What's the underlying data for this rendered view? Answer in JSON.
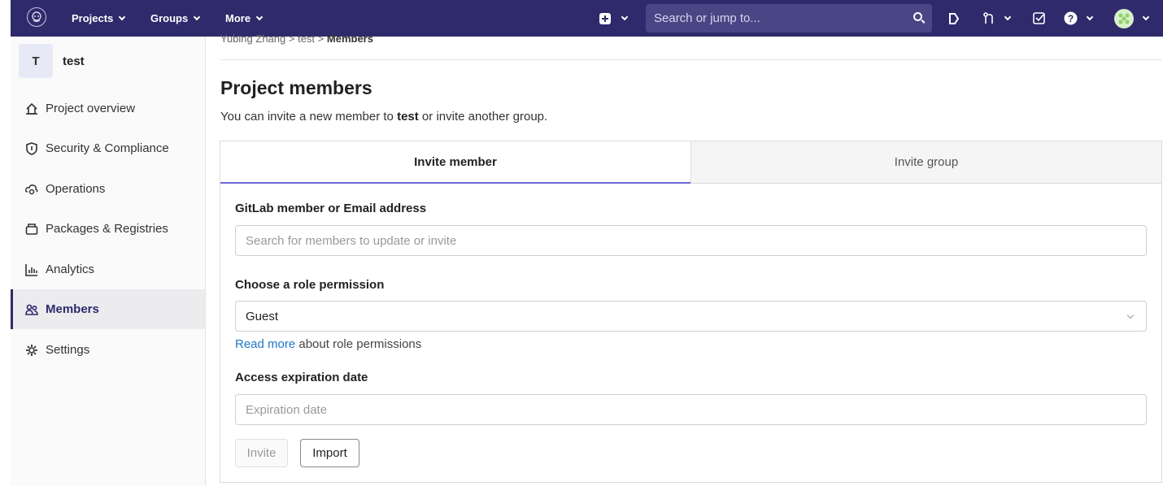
{
  "navbar": {
    "projects": "Projects",
    "groups": "Groups",
    "more": "More",
    "search_placeholder": "Search or jump to..."
  },
  "sidebar": {
    "project_initial": "T",
    "project_name": "test",
    "items": [
      {
        "label": "Project overview",
        "icon": "home-icon"
      },
      {
        "label": "Security & Compliance",
        "icon": "shield-icon"
      },
      {
        "label": "Operations",
        "icon": "cloud-gear-icon"
      },
      {
        "label": "Packages & Registries",
        "icon": "package-icon"
      },
      {
        "label": "Analytics",
        "icon": "chart-icon"
      },
      {
        "label": "Members",
        "icon": "users-icon",
        "active": true
      },
      {
        "label": "Settings",
        "icon": "gear-icon"
      }
    ]
  },
  "breadcrumb": {
    "owner": "Yubing Zhang",
    "sep1": ">",
    "project": "test",
    "sep2": ">",
    "current": "Members"
  },
  "main": {
    "title": "Project members",
    "subtitle_pre": "You can invite a new member to ",
    "subtitle_bold": "test",
    "subtitle_post": " or invite another group."
  },
  "tabs": {
    "invite_member": "Invite member",
    "invite_group": "Invite group"
  },
  "form": {
    "member_label": "GitLab member or Email address",
    "member_placeholder": "Search for members to update or invite",
    "role_label": "Choose a role permission",
    "role_value": "Guest",
    "read_more": "Read more",
    "read_more_suffix": " about role permissions",
    "expiration_label": "Access expiration date",
    "expiration_placeholder": "Expiration date",
    "invite_button": "Invite",
    "import_button": "Import"
  },
  "colors": {
    "navbar": "#2f2a6b",
    "active_tab_underline": "#6e66d6",
    "link": "#1f75cb"
  }
}
